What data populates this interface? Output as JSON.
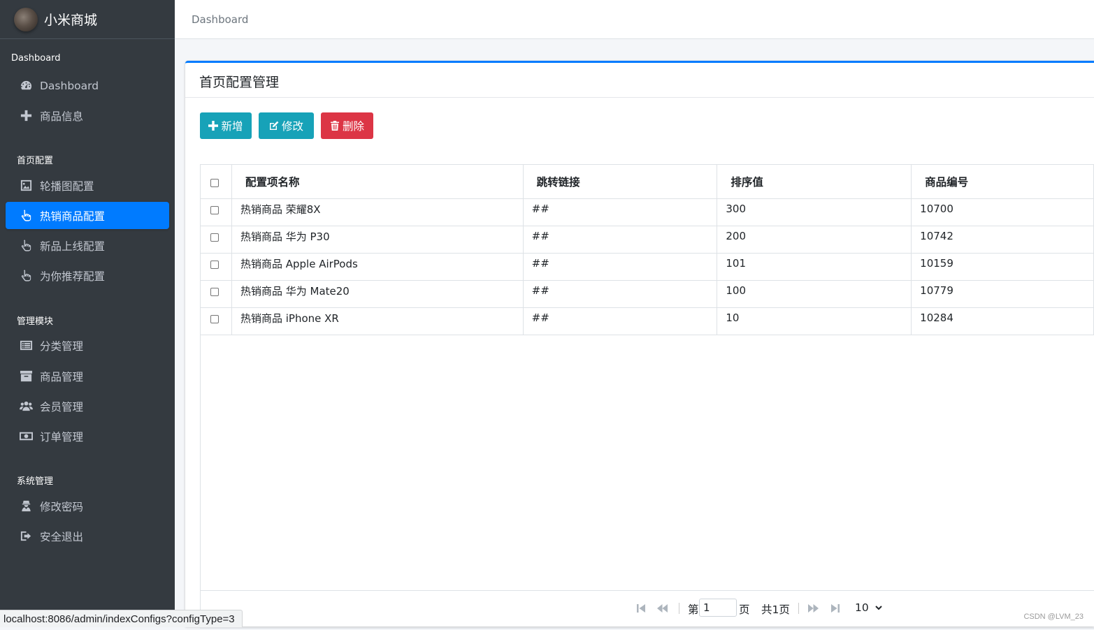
{
  "sidebar": {
    "brand": "小米商城",
    "sections": [
      {
        "header": "Dashboard",
        "items": [
          {
            "label": "Dashboard",
            "icon": "tachometer-icon"
          },
          {
            "label": "商品信息",
            "icon": "plus-icon"
          }
        ]
      },
      {
        "header": "首页配置",
        "items": [
          {
            "label": "轮播图配置",
            "icon": "image-icon"
          },
          {
            "label": "热销商品配置",
            "icon": "hand-pointer-icon",
            "active": true
          },
          {
            "label": "新品上线配置",
            "icon": "hand-pointer-icon"
          },
          {
            "label": "为你推荐配置",
            "icon": "hand-pointer-icon"
          }
        ]
      },
      {
        "header": "管理模块",
        "items": [
          {
            "label": "分类管理",
            "icon": "list-alt-icon"
          },
          {
            "label": "商品管理",
            "icon": "archive-icon"
          },
          {
            "label": "会员管理",
            "icon": "users-icon"
          },
          {
            "label": "订单管理",
            "icon": "money-bill-icon"
          }
        ]
      },
      {
        "header": "系统管理",
        "items": [
          {
            "label": "修改密码",
            "icon": "user-secret-icon"
          },
          {
            "label": "安全退出",
            "icon": "sign-out-icon"
          }
        ]
      }
    ]
  },
  "topnav": {
    "breadcrumb": "Dashboard"
  },
  "card": {
    "title": "首页配置管理",
    "buttons": {
      "add": "新增",
      "edit": "修改",
      "delete": "删除"
    }
  },
  "table": {
    "columns": [
      "配置项名称",
      "跳转链接",
      "排序值",
      "商品编号"
    ],
    "rows": [
      [
        "热销商品 荣耀8X",
        "##",
        "300",
        "10700"
      ],
      [
        "热销商品 华为 P30",
        "##",
        "200",
        "10742"
      ],
      [
        "热销商品 Apple AirPods",
        "##",
        "101",
        "10159"
      ],
      [
        "热销商品 华为 Mate20",
        "##",
        "100",
        "10779"
      ],
      [
        "热销商品 iPhone XR",
        "##",
        "10",
        "10284"
      ]
    ]
  },
  "pager": {
    "page_prefix": "第",
    "page_value": "1",
    "page_suffix": "页",
    "total": "共1页",
    "page_size": "10"
  },
  "statusbar": {
    "url": "localhost:8086/admin/indexConfigs?configType=3"
  },
  "watermark": "CSDN @LVM_23",
  "colors": {
    "primary": "#007bff",
    "info": "#17a2b8",
    "danger": "#dc3545",
    "sidebar_bg": "#343a40"
  }
}
